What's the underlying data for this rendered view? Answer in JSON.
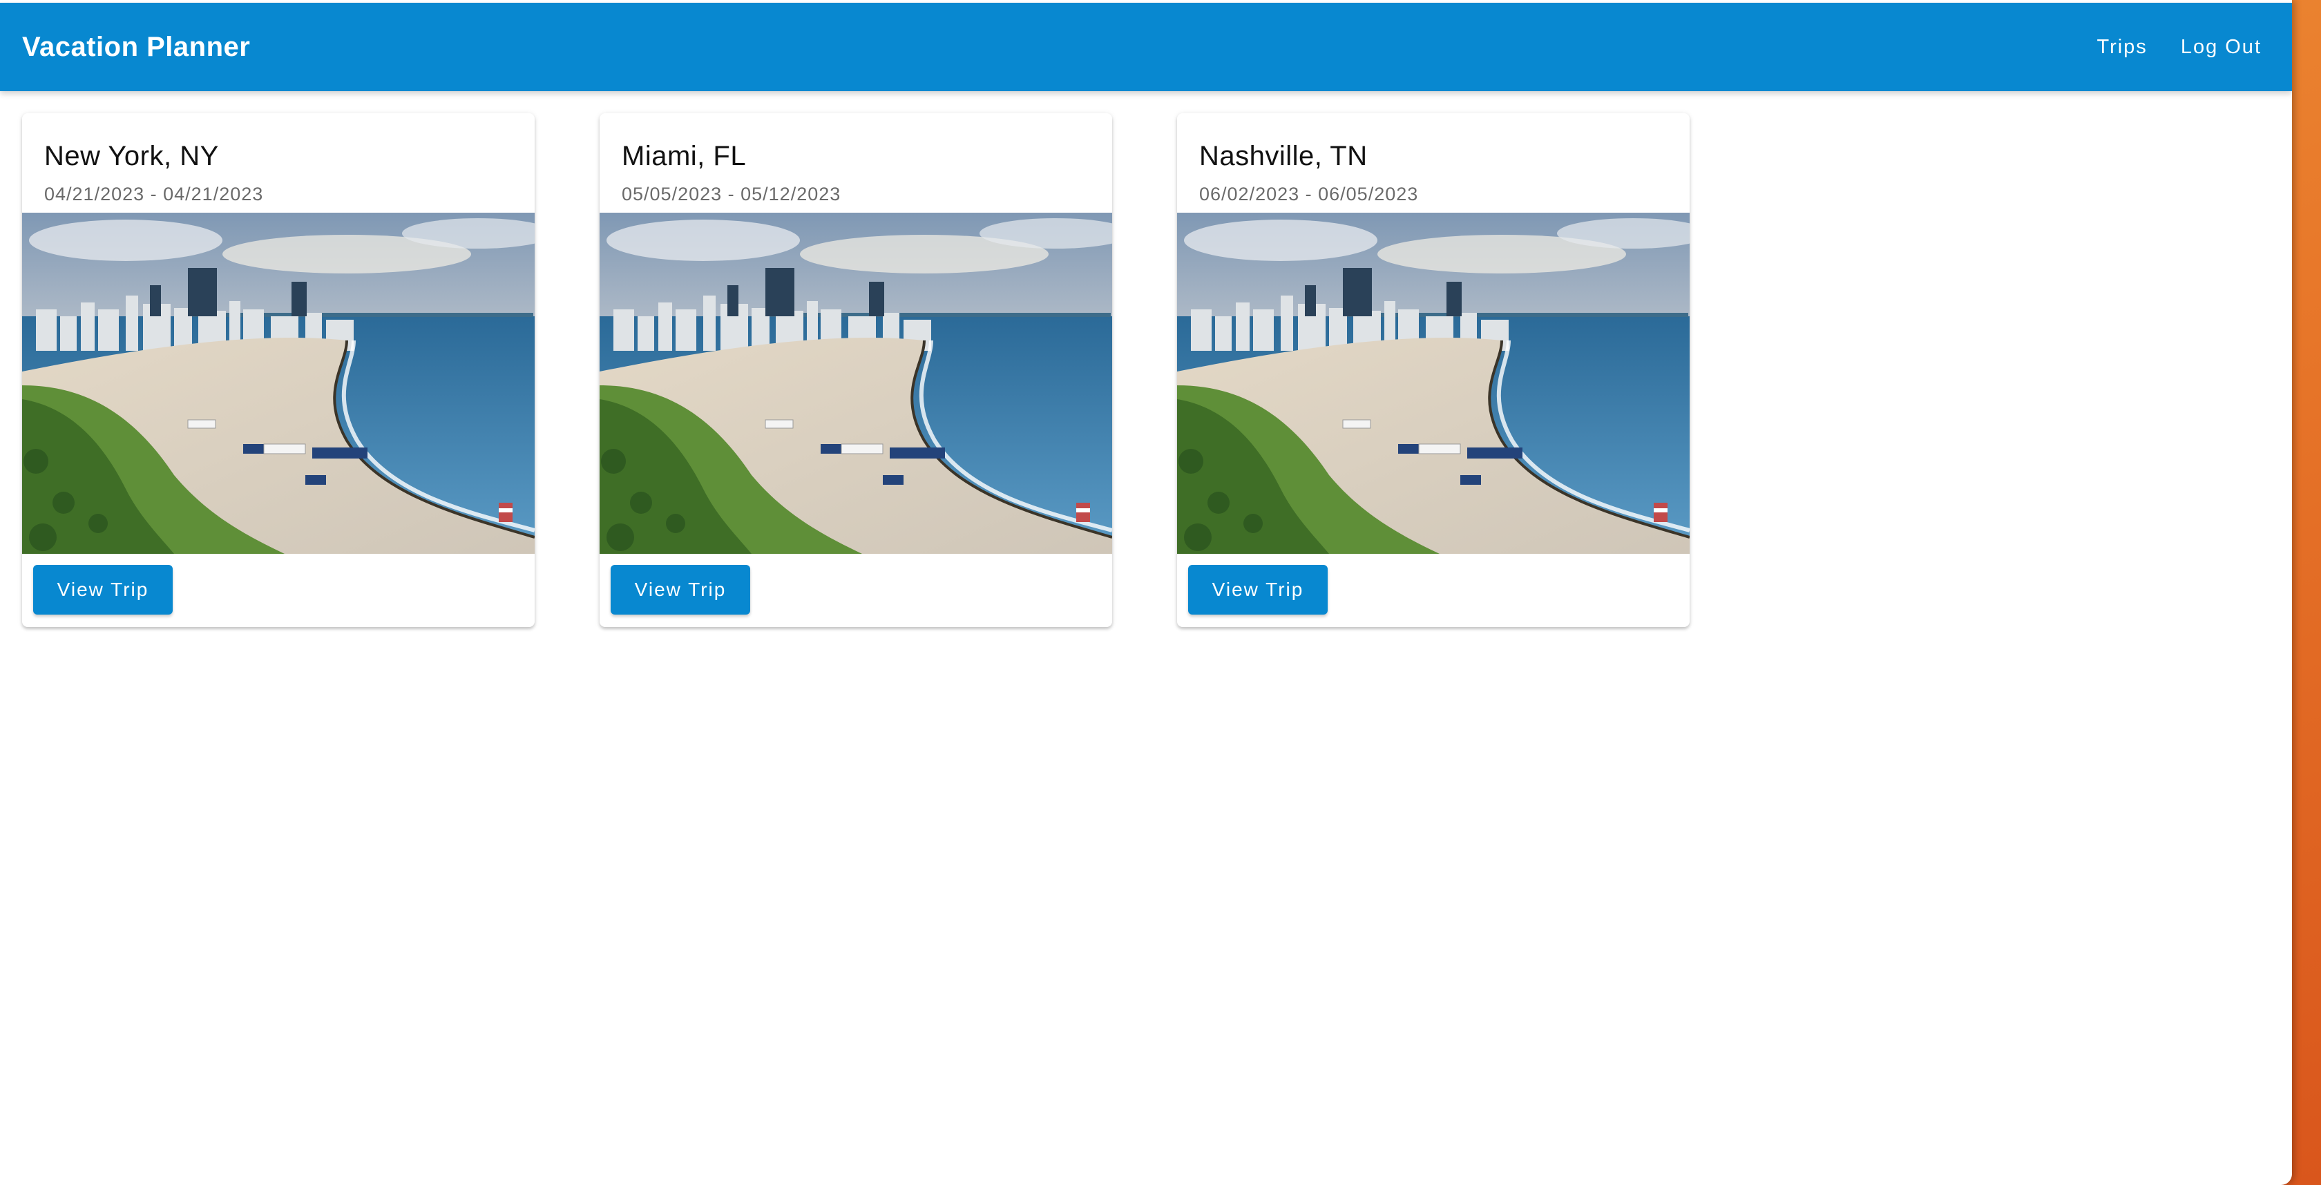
{
  "app": {
    "title": "Vacation Planner"
  },
  "nav": {
    "trips_label": "Trips",
    "logout_label": "Log Out"
  },
  "trips": [
    {
      "name": "New York, NY",
      "dates": "04/21/2023 - 04/21/2023",
      "button_label": "View Trip"
    },
    {
      "name": "Miami, FL",
      "dates": "05/05/2023 - 05/12/2023",
      "button_label": "View Trip"
    },
    {
      "name": "Nashville, TN",
      "dates": "06/02/2023 - 06/05/2023",
      "button_label": "View Trip"
    }
  ],
  "colors": {
    "primary": "#0888d0",
    "desktop_wallpaper": "#e8782a"
  }
}
